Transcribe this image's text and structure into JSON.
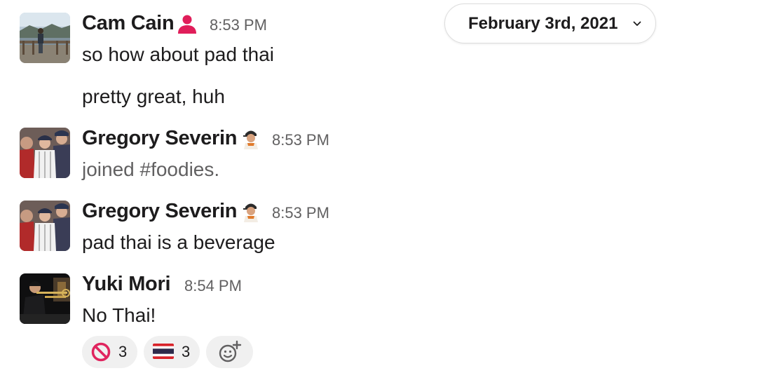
{
  "date_divider": {
    "label": "February 3rd, 2021",
    "icon": "chevron-down-icon"
  },
  "messages": [
    {
      "author": "Cam Cain",
      "status_icon": "person-icon",
      "status_color": "#e01e5a",
      "time": "8:53 PM",
      "lines": [
        "so how about pad thai",
        "pretty great, huh"
      ]
    },
    {
      "author": "Gregory Severin",
      "status_icon": "baseball-player-icon",
      "time": "8:53 PM",
      "lines": [
        "joined #foodies."
      ]
    },
    {
      "author": "Gregory Severin",
      "status_icon": "baseball-player-icon",
      "time": "8:53 PM",
      "lines": [
        "pad thai is a beverage"
      ]
    },
    {
      "author": "Yuki Mori",
      "time": "8:54 PM",
      "lines": [
        "No Thai!"
      ]
    }
  ],
  "reactions": [
    {
      "emoji": "no-entry-sign-icon",
      "count": "3"
    },
    {
      "emoji": "thailand-flag-icon",
      "count": "3"
    },
    {
      "emoji": "add-reaction-icon"
    }
  ]
}
